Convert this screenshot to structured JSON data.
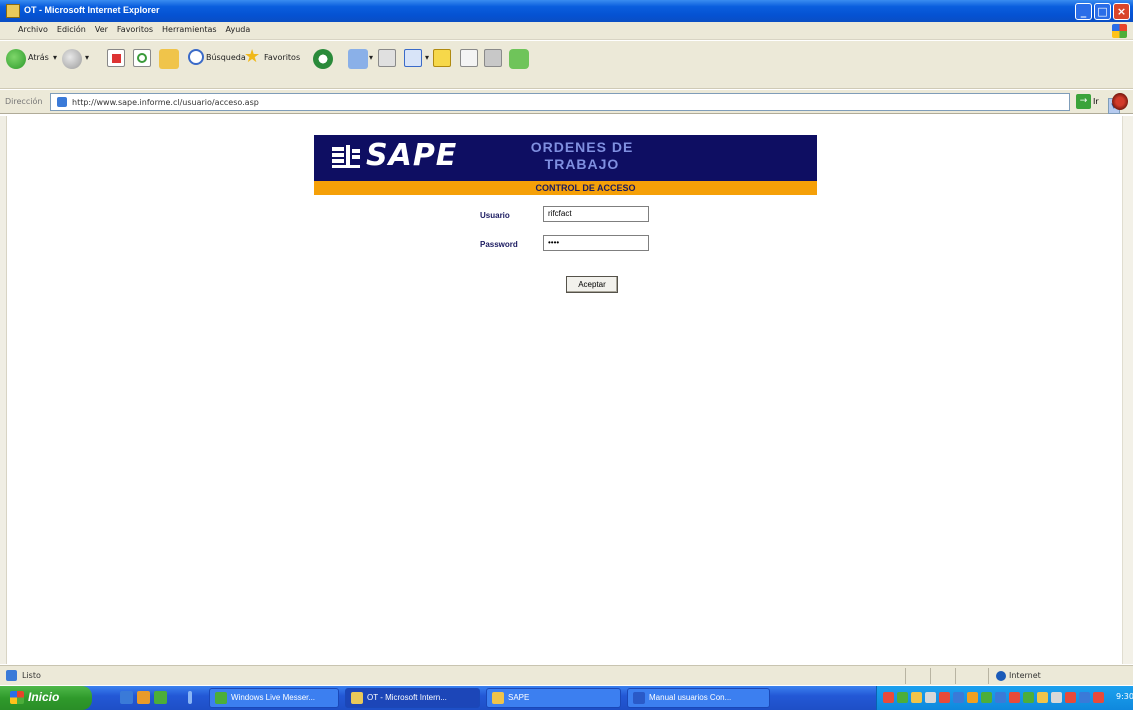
{
  "window": {
    "title": "OT - Microsoft Internet Explorer"
  },
  "menu": [
    "Archivo",
    "Edición",
    "Ver",
    "Favoritos",
    "Herramientas",
    "Ayuda"
  ],
  "toolbar": {
    "back_label": "Atrás",
    "search_label": "Búsqueda",
    "favorites_label": "Favoritos"
  },
  "address": {
    "label": "Dirección",
    "url": "http://www.sape.informe.cl/usuario/acceso.asp",
    "go_label": "Ir"
  },
  "page": {
    "logo_text": "SAPE",
    "title": "ORDENES DE TRABAJO",
    "subtitle": "CONTROL DE ACCESO",
    "usuario_label": "Usuario",
    "usuario_value": "rifcfact",
    "password_label": "Password",
    "password_value": "••••",
    "submit_label": "Aceptar"
  },
  "status": {
    "text": "Listo",
    "zone": "Internet"
  },
  "taskbar": {
    "start_label": "Inicio",
    "tasks": [
      "Windows Live Messer...",
      "OT - Microsoft Intern...",
      "SAPE",
      "Manual usuarios Con..."
    ],
    "clock": "9:30"
  },
  "colors": {
    "banner": "#0e0e62",
    "accent_bar": "#f5a008",
    "title_blue": "#7f8fe0",
    "xp_title": "#0552d2"
  }
}
